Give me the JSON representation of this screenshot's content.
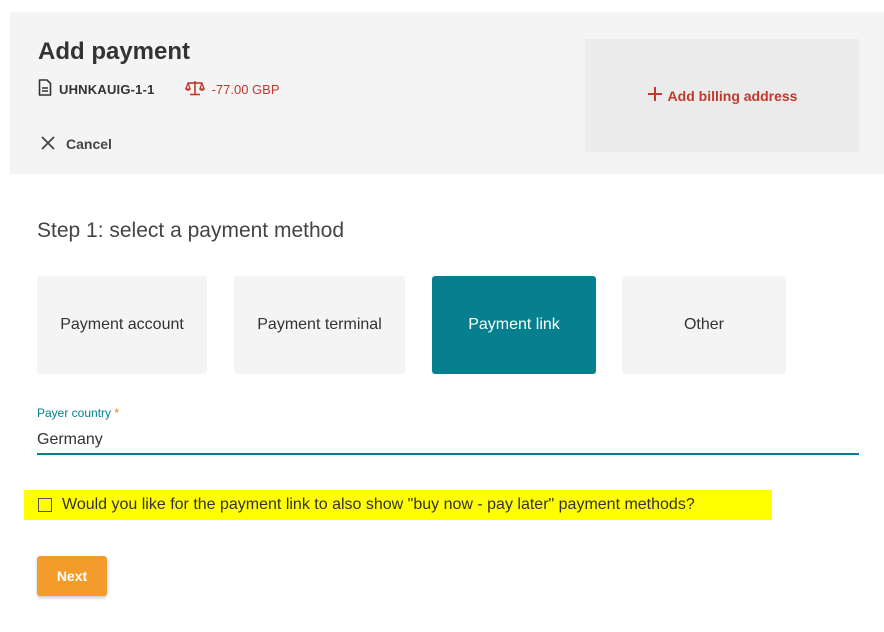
{
  "header": {
    "title": "Add payment",
    "reference": "UHNKAUIG-1-1",
    "balance": "-77.00 GBP",
    "cancel_label": "Cancel",
    "billing_label": "Add billing address"
  },
  "step": {
    "title": "Step 1: select a payment method",
    "methods": [
      {
        "label": "Payment account",
        "selected": false
      },
      {
        "label": "Payment terminal",
        "selected": false
      },
      {
        "label": "Payment link",
        "selected": true
      },
      {
        "label": "Other",
        "selected": false
      }
    ]
  },
  "form": {
    "country_label": "Payer country",
    "required_mark": "*",
    "country_value": "Germany",
    "bnpl_question": "Would you like for the payment link to also show \"buy now - pay later\" payment methods?",
    "bnpl_checked": false,
    "next_label": "Next"
  },
  "colors": {
    "accent": "#06808e",
    "danger": "#c0392b",
    "primary_button": "#f39c2b",
    "highlight": "#ffff00"
  },
  "icons": [
    "document-icon",
    "balance-scale-icon",
    "close-icon",
    "plus-icon"
  ]
}
